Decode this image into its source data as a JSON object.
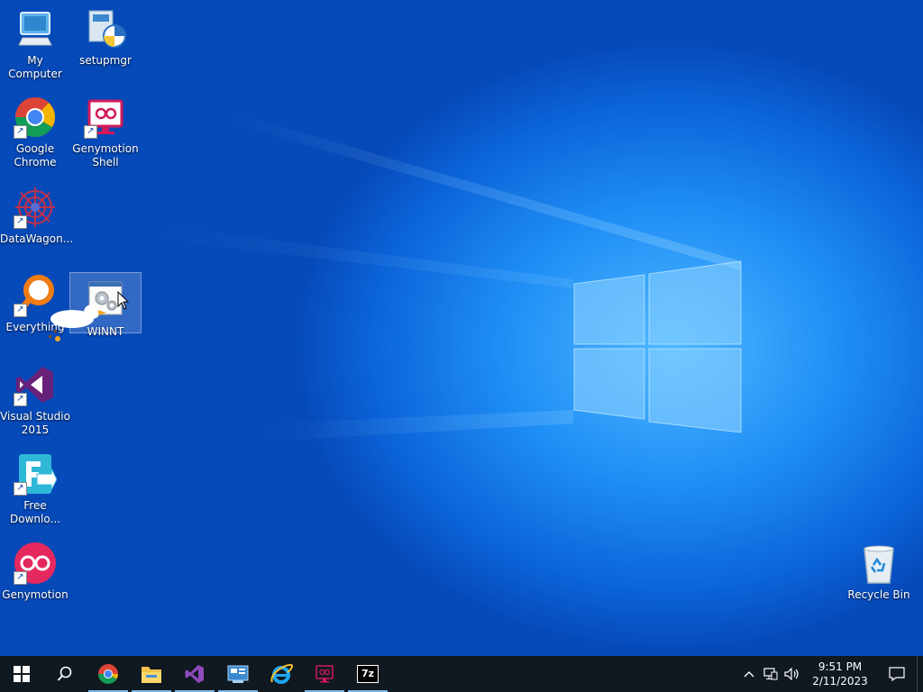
{
  "desktop": {
    "icons": [
      {
        "label": "My Computer",
        "icon": "computer-icon"
      },
      {
        "label": "setupmgr",
        "icon": "setup-icon"
      },
      {
        "label": "Google Chrome",
        "icon": "chrome-icon"
      },
      {
        "label": "Genymotion Shell",
        "icon": "genymotion-shell-icon"
      },
      {
        "label": "DataWagon...",
        "icon": "datawagon-icon"
      },
      {
        "label": "Everything",
        "icon": "everything-search-icon"
      },
      {
        "label": "WINNT",
        "icon": "winnt-gear-icon"
      },
      {
        "label": "Visual Studio 2015",
        "icon": "visual-studio-icon"
      },
      {
        "label": "Free Downlo...",
        "icon": "free-download-manager-icon"
      },
      {
        "label": "Genymotion",
        "icon": "genymotion-icon"
      },
      {
        "label": "Recycle Bin",
        "icon": "recycle-bin-icon"
      }
    ]
  },
  "taskbar": {
    "apps": [
      {
        "name": "start-button",
        "icon": "windows-logo-icon"
      },
      {
        "name": "search-button",
        "icon": "search-icon"
      },
      {
        "name": "taskbar-chrome",
        "icon": "chrome-icon"
      },
      {
        "name": "taskbar-file-explorer",
        "icon": "folder-icon"
      },
      {
        "name": "taskbar-visual-studio",
        "icon": "visual-studio-icon"
      },
      {
        "name": "taskbar-control-panel",
        "icon": "control-panel-icon"
      },
      {
        "name": "taskbar-internet-explorer",
        "icon": "internet-explorer-icon"
      },
      {
        "name": "taskbar-genymotion-shell",
        "icon": "genymotion-shell-icon"
      },
      {
        "name": "taskbar-7zip",
        "icon": "7zip-icon",
        "text": "7z"
      }
    ],
    "clock": {
      "time": "9:51 PM",
      "date": "2/11/2023"
    }
  },
  "colors": {
    "taskbar": "#101820",
    "accent": "#76b9ed",
    "wallpaper": "#0b63d8"
  }
}
